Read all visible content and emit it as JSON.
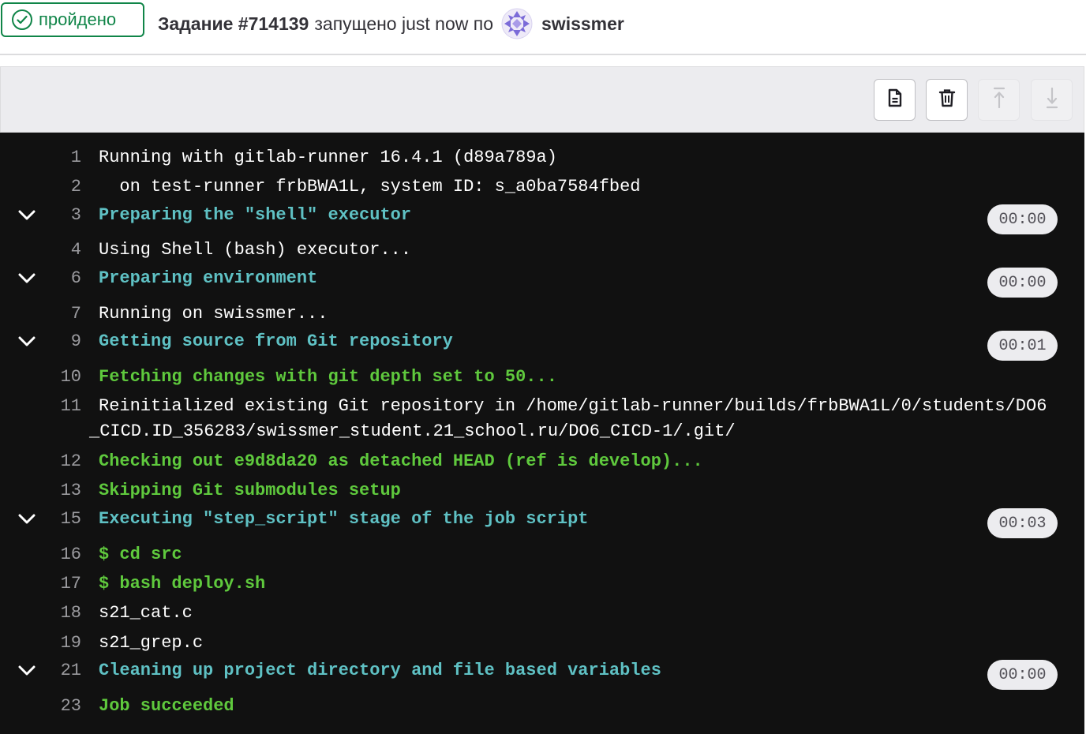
{
  "header": {
    "status_label": "пройдено",
    "job_id": "Задание #714139",
    "started_text": "запущено just now по",
    "username": "swissmer"
  },
  "toolbar": {
    "icons": [
      "raw-log-icon",
      "erase-icon",
      "scroll-to-top-icon",
      "scroll-to-bottom-icon"
    ]
  },
  "log": {
    "lines": [
      {
        "no": "1",
        "text": "Running with gitlab-runner 16.4.1 (d89a789a)",
        "style": "white"
      },
      {
        "no": "2",
        "text": "  on test-runner frbBWA1L, system ID: s_a0ba7584fbed",
        "style": "white"
      },
      {
        "no": "3",
        "text": "Preparing the \"shell\" executor",
        "style": "cyan",
        "section": true,
        "duration": "00:00"
      },
      {
        "no": "4",
        "text": "Using Shell (bash) executor...",
        "style": "white"
      },
      {
        "no": "6",
        "text": "Preparing environment",
        "style": "cyan",
        "section": true,
        "duration": "00:00"
      },
      {
        "no": "7",
        "text": "Running on swissmer...",
        "style": "white"
      },
      {
        "no": "9",
        "text": "Getting source from Git repository",
        "style": "cyan",
        "section": true,
        "duration": "00:01"
      },
      {
        "no": "10",
        "text": "Fetching changes with git depth set to 50...",
        "style": "green"
      },
      {
        "no": "11",
        "text": "Reinitialized existing Git repository in /home/gitlab-runner/builds/frbBWA1L/0/students/DO6",
        "text2": "_CICD.ID_356283/swissmer_student.21_school.ru/DO6_CICD-1/.git/",
        "style": "white"
      },
      {
        "no": "12",
        "text": "Checking out e9d8da20 as detached HEAD (ref is develop)...",
        "style": "green"
      },
      {
        "no": "13",
        "text": "Skipping Git submodules setup",
        "style": "green"
      },
      {
        "no": "15",
        "text": "Executing \"step_script\" stage of the job script",
        "style": "cyan",
        "section": true,
        "duration": "00:03"
      },
      {
        "no": "16",
        "text": "$ cd src",
        "style": "green"
      },
      {
        "no": "17",
        "text": "$ bash deploy.sh",
        "style": "green"
      },
      {
        "no": "18",
        "text": "s21_cat.c",
        "style": "white"
      },
      {
        "no": "19",
        "text": "s21_grep.c",
        "style": "white"
      },
      {
        "no": "21",
        "text": "Cleaning up project directory and file based variables",
        "style": "cyan",
        "section": true,
        "duration": "00:00"
      },
      {
        "no": "23",
        "text": "Job succeeded",
        "style": "green"
      }
    ]
  },
  "colors": {
    "success": "#108548",
    "log_bg": "#111111",
    "section_text": "#5fc1c4",
    "command_text": "#5fc93d",
    "plain_text": "#ffffff"
  }
}
